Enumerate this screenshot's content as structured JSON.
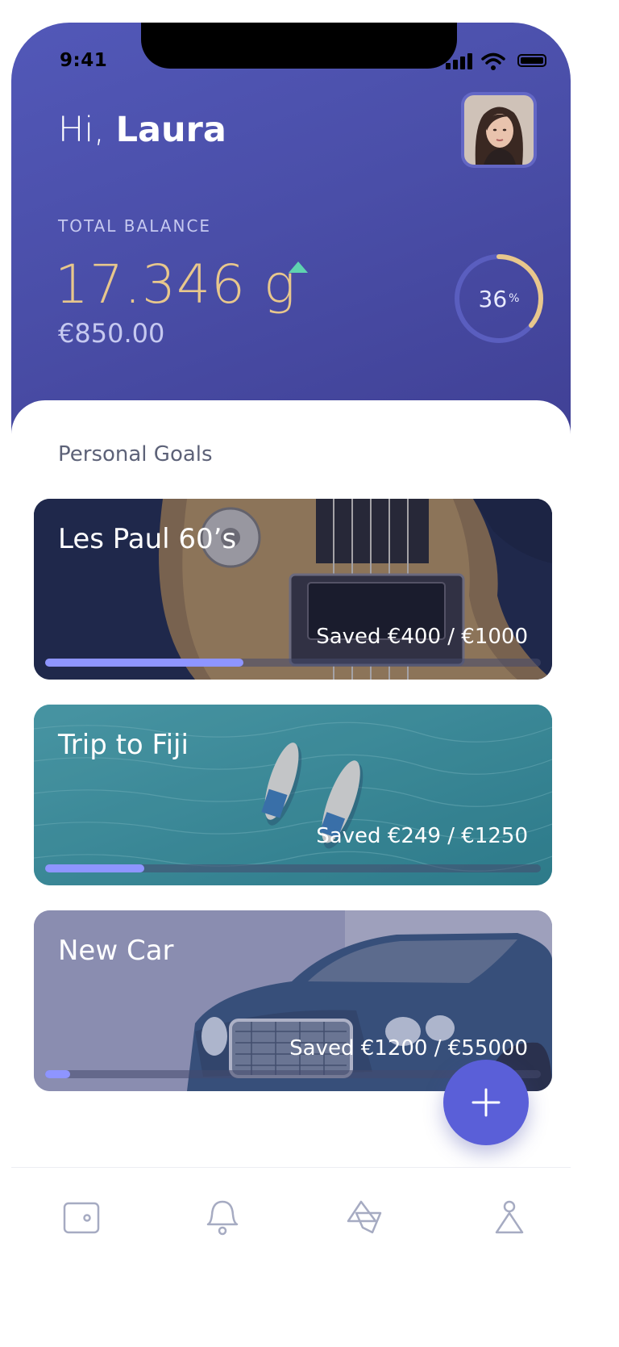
{
  "status_bar": {
    "time": "9:41"
  },
  "header": {
    "greeting": "Hi,",
    "user_name": "Laura",
    "balance_label": "TOTAL BALANCE",
    "balance_value": "17.346 g",
    "balance_currency": "€850.00",
    "progress_percent": "36",
    "progress_unit": "%",
    "progress_fraction": 0.36
  },
  "goals_section": {
    "title": "Personal Goals",
    "goals": [
      {
        "title": "Les Paul 60’s",
        "saved_text": "Saved €400 / €1000",
        "progress": 0.4
      },
      {
        "title": "Trip to Fiji",
        "saved_text": "Saved €249 / €1250",
        "progress": 0.2
      },
      {
        "title": "New Car",
        "saved_text": "Saved €1200 / €55000",
        "progress": 0.05
      }
    ]
  },
  "tabbar": {
    "items": [
      {
        "icon": "wallet-icon"
      },
      {
        "icon": "bell-icon"
      },
      {
        "icon": "shapes-icon"
      },
      {
        "icon": "profile-icon"
      }
    ]
  },
  "colors": {
    "header": "#4a4ea8",
    "accent_gold": "#e8c78c",
    "progress_fill": "#8e95ff",
    "fab": "#5a5fd8",
    "trend_up": "#5fd3b0"
  }
}
